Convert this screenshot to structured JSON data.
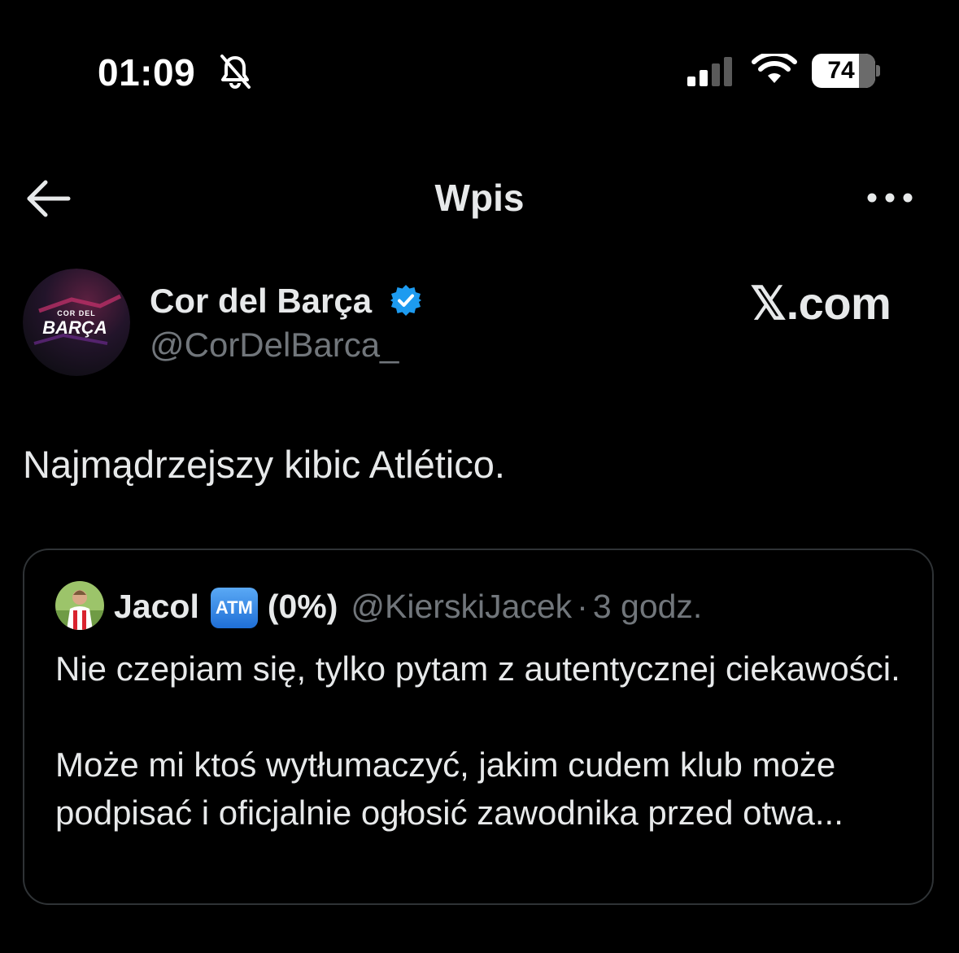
{
  "status_bar": {
    "time": "01:09",
    "battery_label": "74",
    "battery_level": 0.74,
    "icons": [
      "bell-off-icon",
      "cellular-signal-icon",
      "wifi-icon",
      "battery-icon"
    ]
  },
  "header": {
    "title": "Wpis",
    "back_icon": "arrow-left-icon",
    "more_icon": "more-horizontal-icon"
  },
  "tweet": {
    "author_name": "Cor del Barça",
    "author_handle": "@CorDelBarca_",
    "avatar_text_top": "COR DEL",
    "avatar_text_main": "BARÇA",
    "verified": true,
    "text": "Najmądrzejszy kibic Atlético."
  },
  "watermark": "𝕏.com",
  "quoted_tweet": {
    "author_name": "Jacol",
    "badge": "ATM",
    "name_suffix": "(0%)",
    "handle": "@KierskiJacek",
    "separator": "·",
    "time": "3 godz.",
    "paragraph_1": "Nie czepiam się, tylko pytam z autentycznej ciekawości.",
    "paragraph_2": "Może mi ktoś wytłumaczyć, jakim cudem klub może podpisać i oficjalnie ogłosić zawodnika przed otwa..."
  },
  "colors": {
    "background": "#000000",
    "primary_text": "#e7e9ea",
    "secondary_text": "#71767b",
    "border": "#2f3336",
    "verified_blue": "#1d9bf0"
  }
}
